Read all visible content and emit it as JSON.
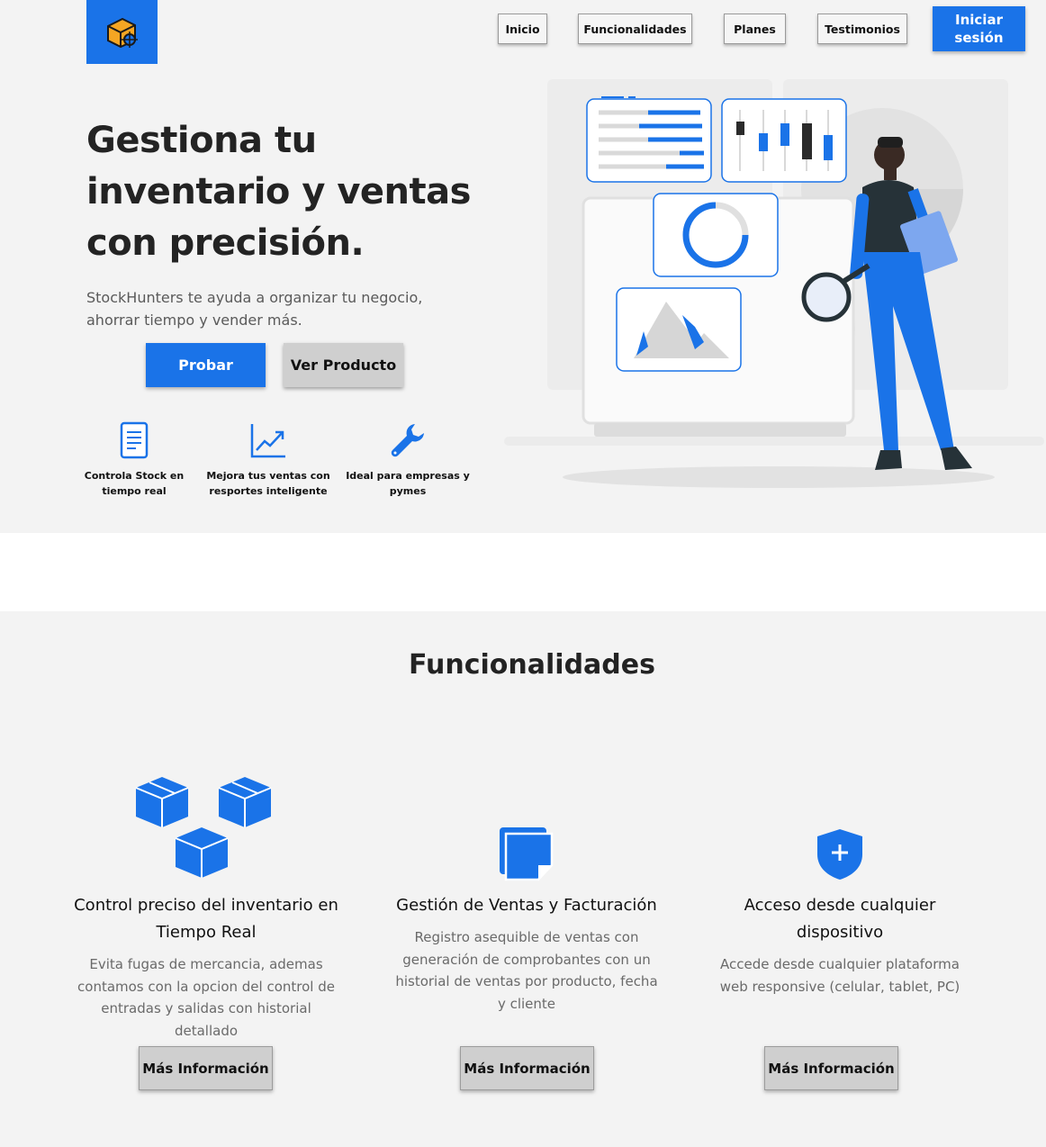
{
  "nav": {
    "items": [
      "Inicio",
      "Funcionalidades",
      "Planes",
      "Testimonios"
    ],
    "login_label": "Iniciar sesión",
    "logo_icon": "box-target-icon"
  },
  "hero": {
    "title": "Gestiona tu inventario y ventas con precisión.",
    "subtitle": "StockHunters te ayuda a organizar tu negocio, ahorrar tiempo y vender más.",
    "primary_button": "Probar",
    "secondary_button": "Ver Producto",
    "mini_features": [
      {
        "label": "Controla Stock en tiempo real",
        "icon": "document-icon"
      },
      {
        "label": "Mejora tus ventas con resportes inteligente",
        "icon": "trending-up-icon"
      },
      {
        "label": "Ideal para empresas y pymes",
        "icon": "wrench-icon"
      }
    ],
    "illustration": "person-analyzing-dashboard-illustration"
  },
  "features": {
    "title": "Funcionalidades",
    "cards": [
      {
        "title": "Control preciso del inventario en Tiempo Real",
        "description": "Evita fugas de mercancia, ademas contamos con la opcion del control de entradas y salidas con historial detallado",
        "button": "Más Información",
        "icon": "boxes-icon"
      },
      {
        "title": "Gestión de Ventas y Facturación",
        "description": "Registro asequible de ventas con generación de comprobantes con un historial de ventas por producto, fecha y cliente",
        "button": "Más Información",
        "icon": "invoice-stack-icon"
      },
      {
        "title": "Acceso desde cualquier dispositivo",
        "description": "Accede desde cualquier plataforma web responsive (celular, tablet, PC)",
        "button": "Más Información",
        "icon": "shield-plus-icon"
      }
    ]
  },
  "colors": {
    "accent": "#1a73e8",
    "background": "#f3f3f3",
    "button_gray": "#cfcfcf",
    "logo_orange": "#f5a623"
  }
}
